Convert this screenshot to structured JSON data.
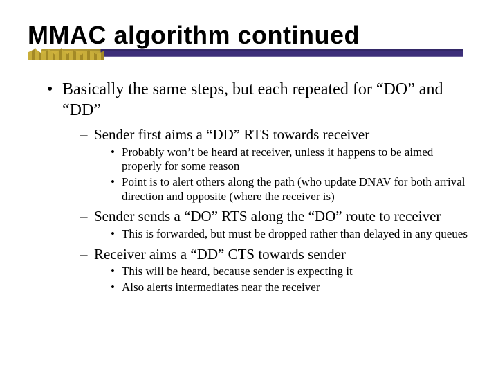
{
  "slide": {
    "title": "MMAC algorithm continued",
    "bullets": [
      {
        "text": "Basically the same steps, but each repeated for “DO” and “DD”",
        "children": [
          {
            "text": "Sender first aims a “DD” RTS towards receiver",
            "children": [
              {
                "text": "Probably won’t be heard at receiver, unless it happens to be aimed properly for some reason"
              },
              {
                "text": "Point is to alert others along the path (who update DNAV for both arrival direction and opposite (where the receiver is)"
              }
            ]
          },
          {
            "text": "Sender sends a “DO” RTS along the “DO” route to receiver",
            "children": [
              {
                "text": "This is forwarded, but must be dropped rather than delayed in any queues"
              }
            ]
          },
          {
            "text": "Receiver aims a “DD” CTS towards sender",
            "children": [
              {
                "text": "This will be heard, because sender is expecting it"
              },
              {
                "text": "Also alerts intermediates near the receiver"
              }
            ]
          }
        ]
      }
    ]
  }
}
